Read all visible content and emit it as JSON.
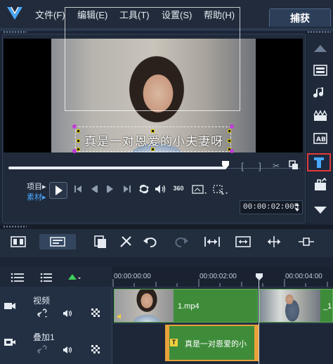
{
  "menu": {
    "file": "文件(F)",
    "edit": "编辑(E)",
    "tools": "工具(T)",
    "settings": "设置(S)",
    "help": "帮助(H)",
    "capture_tab": "捕获"
  },
  "preview": {
    "subtitle": "真是一对恩爱的小夫妻呀"
  },
  "player": {
    "mode_project": "项目▸",
    "mode_clip": "素材▸",
    "timecode": "00:00:02:005",
    "scrub_progress": 0.72
  },
  "timeline": {
    "ruler": [
      "00:00:00:00",
      "00:00:02:00",
      "00:00:04:00"
    ],
    "tracks": [
      {
        "name": "视频",
        "clip_label": "1.mp4",
        "clip_label_2": "_1"
      },
      {
        "name": "叠加1",
        "clip_label": "真是一对恩爱的小"
      }
    ]
  },
  "colors": {
    "accent_red": "#e23a3a",
    "clip_green": "#3e8c3a",
    "title_clip_border": "#e8a23a",
    "title_icon_blue": "#4aa8ff"
  },
  "icons": {
    "right_toolbar": [
      "up-arrow-icon",
      "media-icon",
      "audio-icon",
      "transition-icon",
      "instant-project-icon",
      "title-icon",
      "filter-icon",
      "down-arrow-icon"
    ]
  }
}
